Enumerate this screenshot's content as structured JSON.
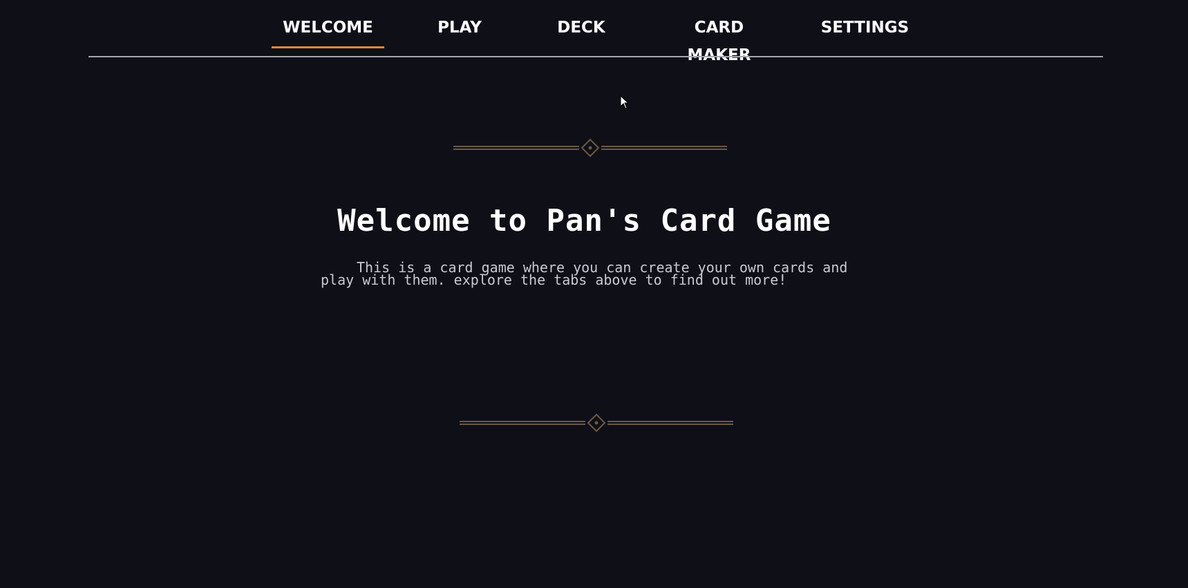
{
  "nav": {
    "tabs": [
      {
        "label": "WELCOME",
        "active": true
      },
      {
        "label": "PLAY",
        "active": false
      },
      {
        "label": "DECK",
        "active": false
      },
      {
        "label": "CARD MAKER",
        "active": false
      },
      {
        "label": "SETTINGS",
        "active": false
      }
    ]
  },
  "main": {
    "title": "Welcome to Pan's Card Game",
    "intro": "This is a card game where you can create your own cards and play with them. explore the tabs above to find out more!"
  },
  "colors": {
    "background": "#0f0f17",
    "active_underline": "#e08a2c",
    "ornament": "#6b5a44",
    "divider": "#a6a6b0"
  },
  "icons": {
    "ornament": "diamond-divider-icon",
    "cursor": "mouse-pointer-icon"
  }
}
